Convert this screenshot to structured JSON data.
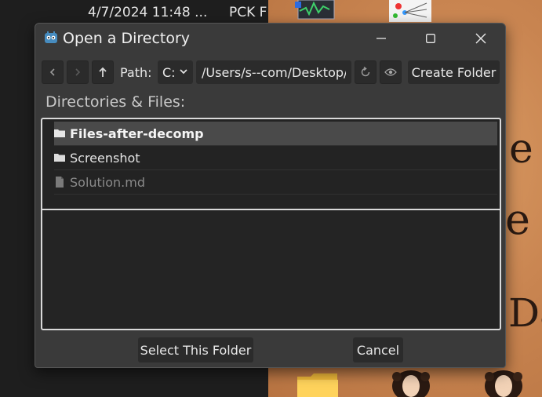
{
  "background": {
    "timestamp": "4/7/2024 11:48 ...",
    "pck_text": "PCK F",
    "glyphs": [
      "e",
      "e",
      "Da"
    ]
  },
  "dialog": {
    "title": "Open a Directory",
    "app_icon": "godot-icon",
    "window_controls": [
      "minimize-icon",
      "maximize-icon",
      "close-icon"
    ]
  },
  "toolbar": {
    "back_icon": "chevron-left-icon",
    "forward_icon": "chevron-right-icon",
    "up_icon": "arrow-up-icon",
    "path_label": "Path:",
    "drive": "C:",
    "path_value": "/Users/s--com/Desktop/",
    "refresh_icon": "refresh-icon",
    "toggle_hidden_icon": "eye-icon",
    "create_folder_label": "Create Folder"
  },
  "section_label": "Directories & Files:",
  "items": [
    {
      "name": "Files-after-decomp",
      "type": "folder",
      "selected": true
    },
    {
      "name": "Screenshot",
      "type": "folder",
      "selected": false
    },
    {
      "name": "Solution.md",
      "type": "file",
      "selected": false
    }
  ],
  "buttons": {
    "select": "Select This Folder",
    "cancel": "Cancel"
  },
  "colors": {
    "dialog_bg": "#3a3a3a",
    "panel_bg": "#232323",
    "selected_row": "#4a4a4a",
    "border": "#d9d9d9",
    "desktop_orange": "#c98551"
  }
}
